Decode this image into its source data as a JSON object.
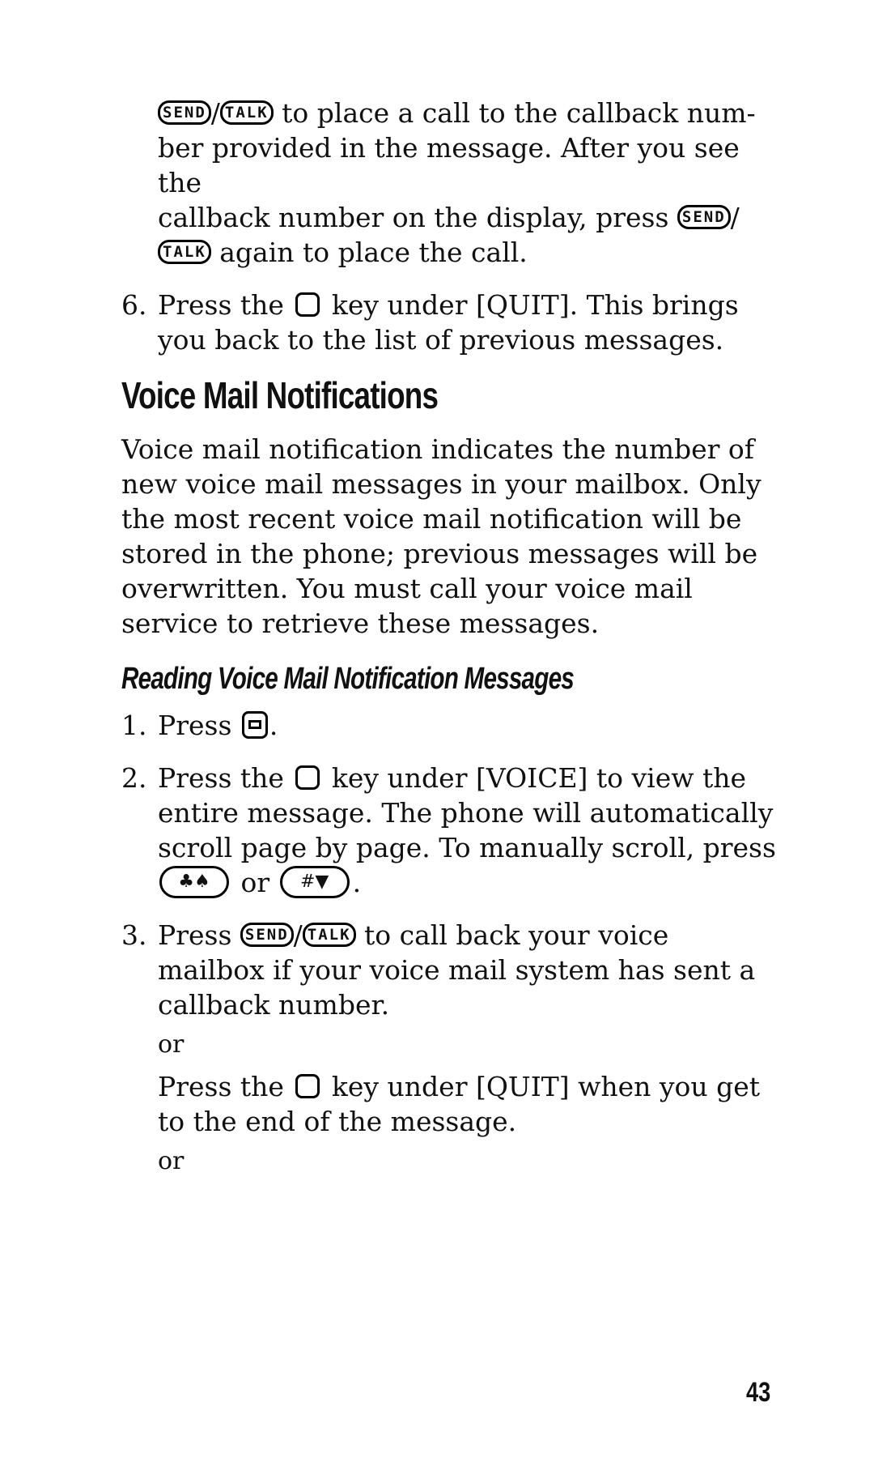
{
  "keys": {
    "send": "SEND",
    "talk": "TALK",
    "slash": "/",
    "scroll_up": "♣♠",
    "scroll_down": "#▼"
  },
  "continued": {
    "text1": " to place a call to the callback num-",
    "line2": "ber provided in the message. After you see the",
    "line3": "callback number on the display, press ",
    "line4": " again to place the call."
  },
  "step6": {
    "num": "6.",
    "pre": "Press the ",
    "post": " key under [QUIT]. This brings you back to the list of previous messages."
  },
  "section": {
    "title": "Voice Mail Notifications",
    "intro": "Voice mail notification indicates the number of new voice mail messages in your mailbox.  Only the most recent voice mail notification will be stored in the phone; previous messages will be overwritten. You must call your voice mail service to retrieve these messages."
  },
  "subsection": {
    "title": "Reading Voice Mail Notification Messages",
    "steps": [
      {
        "num": "1.",
        "pre": "Press ",
        "post": "."
      },
      {
        "num": "2.",
        "pre": "Press the ",
        "post": " key under [VOICE] to view the entire message. The phone will automatically scroll page by page. To manually scroll, press",
        "or": " or ",
        "end": "."
      },
      {
        "num": "3.",
        "pre": "Press ",
        "post": " to call back your voice mailbox if your voice mail system has sent a callback number."
      }
    ],
    "or1": "or",
    "alt_pre": "Press the ",
    "alt_post": " key under  [QUIT] when you get to the end of the message.",
    "or2": "or"
  },
  "page_number": "43"
}
